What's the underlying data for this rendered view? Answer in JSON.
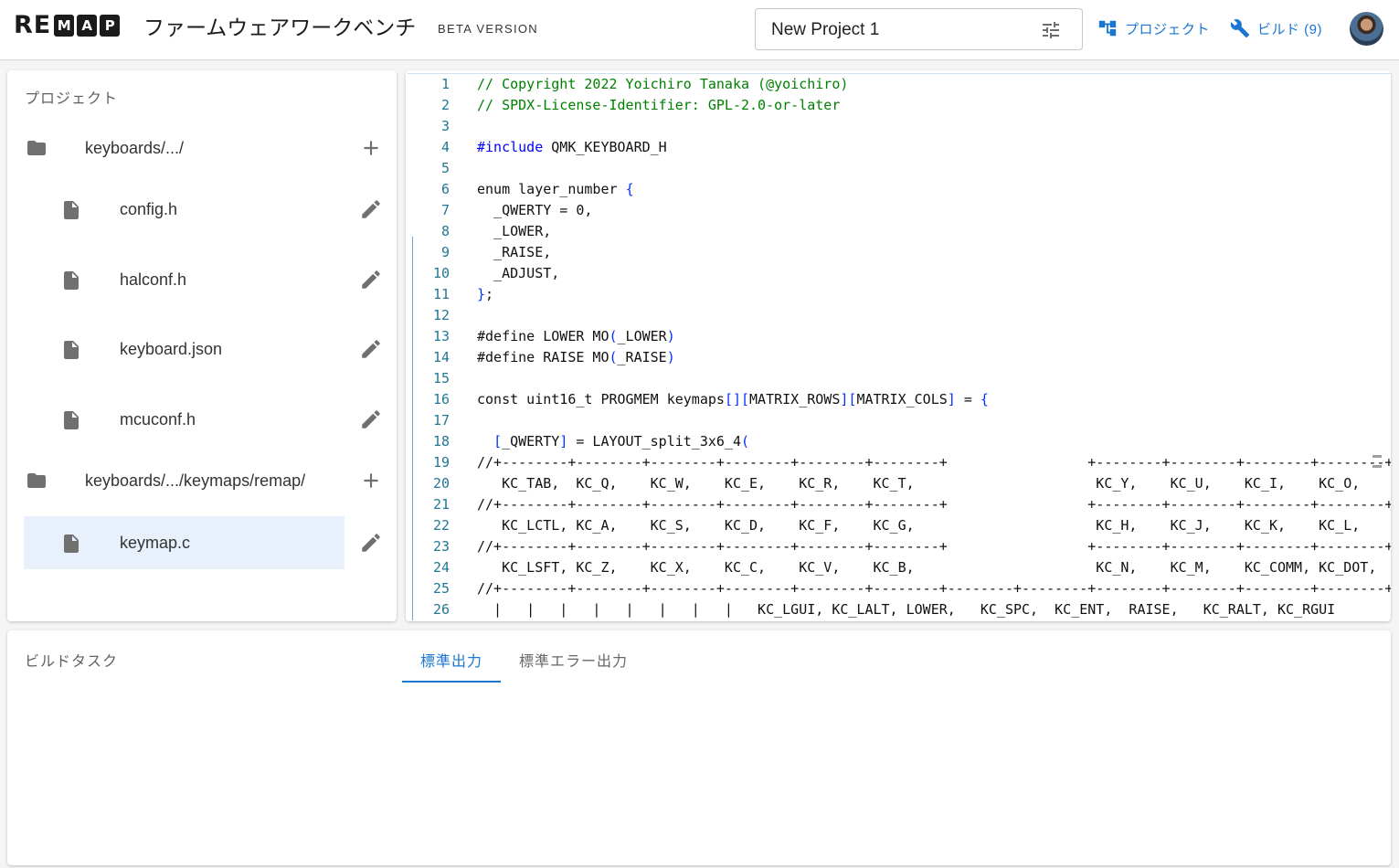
{
  "header": {
    "logo": {
      "plain": "RE",
      "boxed": [
        "M",
        "A",
        "P"
      ]
    },
    "title": "ファームウェアワークベンチ",
    "badge": "BETA VERSION",
    "project_name": "New Project 1",
    "project_link": "プロジェクト",
    "build_link": "ビルド (9)",
    "accent_color": "#1976d2"
  },
  "project_panel": {
    "title": "プロジェクト",
    "tree": [
      {
        "type": "folder",
        "label": "keyboards/.../",
        "action_icon": "plus-icon"
      },
      {
        "type": "file",
        "label": "config.h",
        "action_icon": "pencil-icon"
      },
      {
        "type": "file",
        "label": "halconf.h",
        "action_icon": "pencil-icon"
      },
      {
        "type": "file",
        "label": "keyboard.json",
        "action_icon": "pencil-icon"
      },
      {
        "type": "file",
        "label": "mcuconf.h",
        "action_icon": "pencil-icon"
      },
      {
        "type": "folder",
        "label": "keyboards/.../keymaps/remap/",
        "action_icon": "plus-icon"
      },
      {
        "type": "file",
        "label": "keymap.c",
        "action_icon": "pencil-icon",
        "selected": true
      }
    ]
  },
  "editor": {
    "lines": [
      "// Copyright 2022 Yoichiro Tanaka (@yoichiro)",
      "// SPDX-License-Identifier: GPL-2.0-or-later",
      "",
      "#include QMK_KEYBOARD_H",
      "",
      "enum layer_number {",
      "  _QWERTY = 0,",
      "  _LOWER,",
      "  _RAISE,",
      "  _ADJUST,",
      "};",
      "",
      "#define LOWER MO(_LOWER)",
      "#define RAISE MO(_RAISE)",
      "",
      "const uint16_t PROGMEM keymaps[][MATRIX_ROWS][MATRIX_COLS] = {",
      "",
      "  [_QWERTY] = LAYOUT_split_3x6_4(",
      "//+--------+--------+--------+--------+--------+--------+                 +--------+--------+--------+--------+--------+",
      "   KC_TAB,  KC_Q,    KC_W,    KC_E,    KC_R,    KC_T,                      KC_Y,    KC_U,    KC_I,    KC_O,    KC_P,",
      "//+--------+--------+--------+--------+--------+--------+                 +--------+--------+--------+--------+--------+",
      "   KC_LCTL, KC_A,    KC_S,    KC_D,    KC_F,    KC_G,                      KC_H,    KC_J,    KC_K,    KC_L,    KC_SCLN,",
      "//+--------+--------+--------+--------+--------+--------+                 +--------+--------+--------+--------+--------+",
      "   KC_LSFT, KC_Z,    KC_X,    KC_C,    KC_V,    KC_B,                      KC_N,    KC_M,    KC_COMM, KC_DOT,  KC_SLSH,",
      "//+--------+--------+--------+--------+--------+--------+--------+--------+--------+--------+--------+--------+--------+",
      "  |   |   |   |   |   |   |   |   KC_LGUI, KC_LALT, LOWER,   KC_SPC,  KC_ENT,  RAISE,   KC_RALT, KC_RGUI"
    ]
  },
  "build_panel": {
    "title": "ビルドタスク",
    "tabs": [
      {
        "label": "標準出力",
        "active": true
      },
      {
        "label": "標準エラー出力",
        "active": false
      }
    ]
  }
}
